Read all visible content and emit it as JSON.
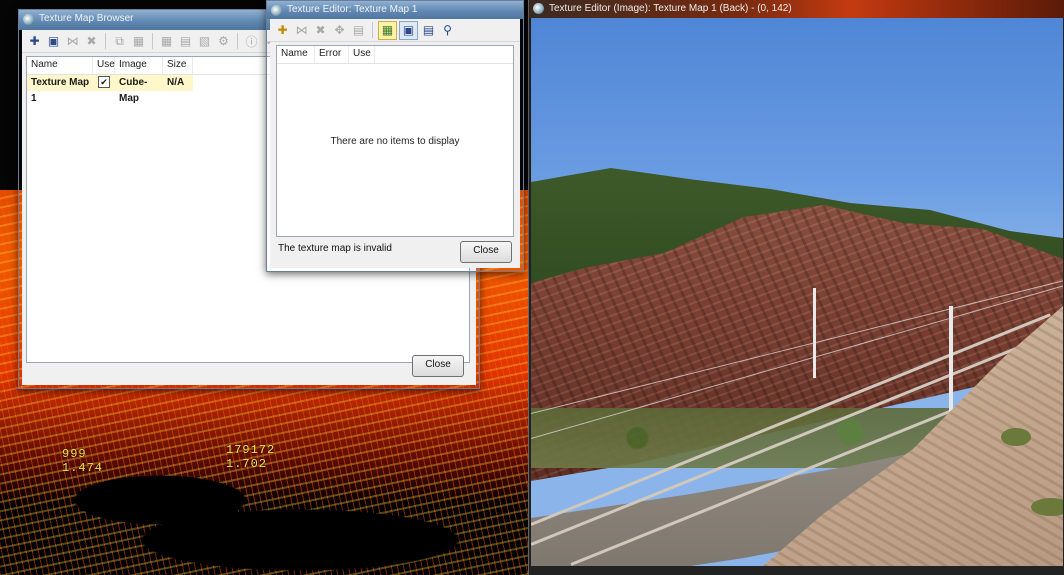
{
  "browser": {
    "title": "Texture Map Browser",
    "columns": [
      "Name",
      "Use",
      "Image",
      "Size"
    ],
    "rows": [
      {
        "name": "Texture Map 1",
        "use": "✔",
        "image": "Cube-Map",
        "size": "N/A"
      }
    ],
    "close_label": "Close"
  },
  "editor": {
    "title": "Texture Editor: Texture Map 1",
    "columns": [
      "Name",
      "Error",
      "Use"
    ],
    "empty_message": "There are no items to display",
    "status": "The texture map is invalid",
    "close_label": "Close"
  },
  "image_editor": {
    "title": "Texture Editor (Image): Texture Map 1 (Back) - (0, 142)"
  },
  "point_cloud": {
    "labels": [
      {
        "line1": "999",
        "line2": "1.474"
      },
      {
        "line1": "179172",
        "line2": "1.702"
      }
    ]
  },
  "colors": {
    "selected_row": "#fdf7c9",
    "title_blue": "#5f86b0"
  }
}
